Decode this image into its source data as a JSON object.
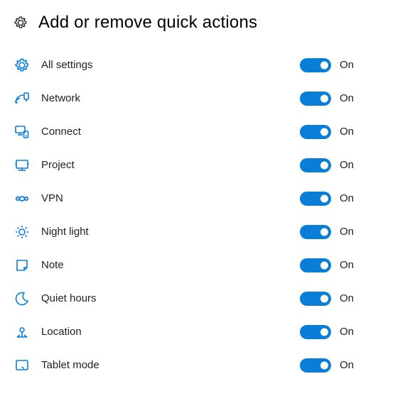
{
  "header": {
    "title": "Add or remove quick actions"
  },
  "colors": {
    "accent": "#0a7dd6",
    "iconStroke": "#0a7dd6"
  },
  "items": [
    {
      "icon": "gear-outline-icon",
      "label": "All settings",
      "state": "On",
      "on": true
    },
    {
      "icon": "network-icon",
      "label": "Network",
      "state": "On",
      "on": true
    },
    {
      "icon": "connect-icon",
      "label": "Connect",
      "state": "On",
      "on": true
    },
    {
      "icon": "project-icon",
      "label": "Project",
      "state": "On",
      "on": true
    },
    {
      "icon": "vpn-icon",
      "label": "VPN",
      "state": "On",
      "on": true
    },
    {
      "icon": "night-light-icon",
      "label": "Night light",
      "state": "On",
      "on": true
    },
    {
      "icon": "note-icon",
      "label": "Note",
      "state": "On",
      "on": true
    },
    {
      "icon": "quiet-hours-icon",
      "label": "Quiet hours",
      "state": "On",
      "on": true
    },
    {
      "icon": "location-icon",
      "label": "Location",
      "state": "On",
      "on": true
    },
    {
      "icon": "tablet-mode-icon",
      "label": "Tablet mode",
      "state": "On",
      "on": true
    }
  ]
}
